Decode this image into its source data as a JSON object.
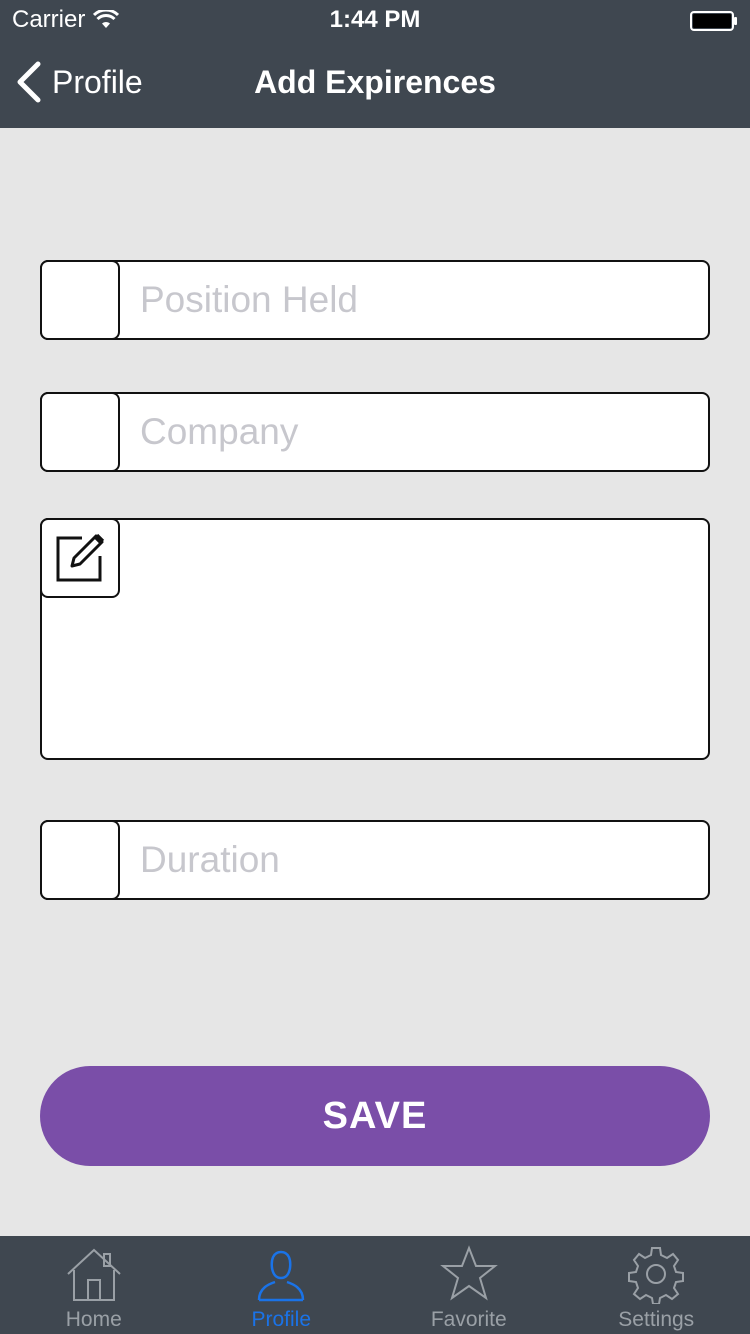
{
  "status_bar": {
    "carrier": "Carrier",
    "time": "1:44 PM"
  },
  "nav": {
    "back_label": "Profile",
    "title": "Add Expirences"
  },
  "form": {
    "position_placeholder": "Position Held",
    "company_placeholder": "Company",
    "duration_placeholder": "Duration"
  },
  "save_label": "SAVE",
  "tabbar": {
    "items": [
      {
        "label": "Home",
        "icon": "home-icon"
      },
      {
        "label": "Profile",
        "icon": "person-icon"
      },
      {
        "label": "Favorite",
        "icon": "star-icon"
      },
      {
        "label": "Settings",
        "icon": "gear-icon"
      }
    ],
    "active_color": "#1a73e8",
    "inactive_color": "#9aa0a6"
  },
  "colors": {
    "header_bg": "#3f4750",
    "save_button": "#7a4ea8",
    "page_bg": "#e6e6e6"
  }
}
